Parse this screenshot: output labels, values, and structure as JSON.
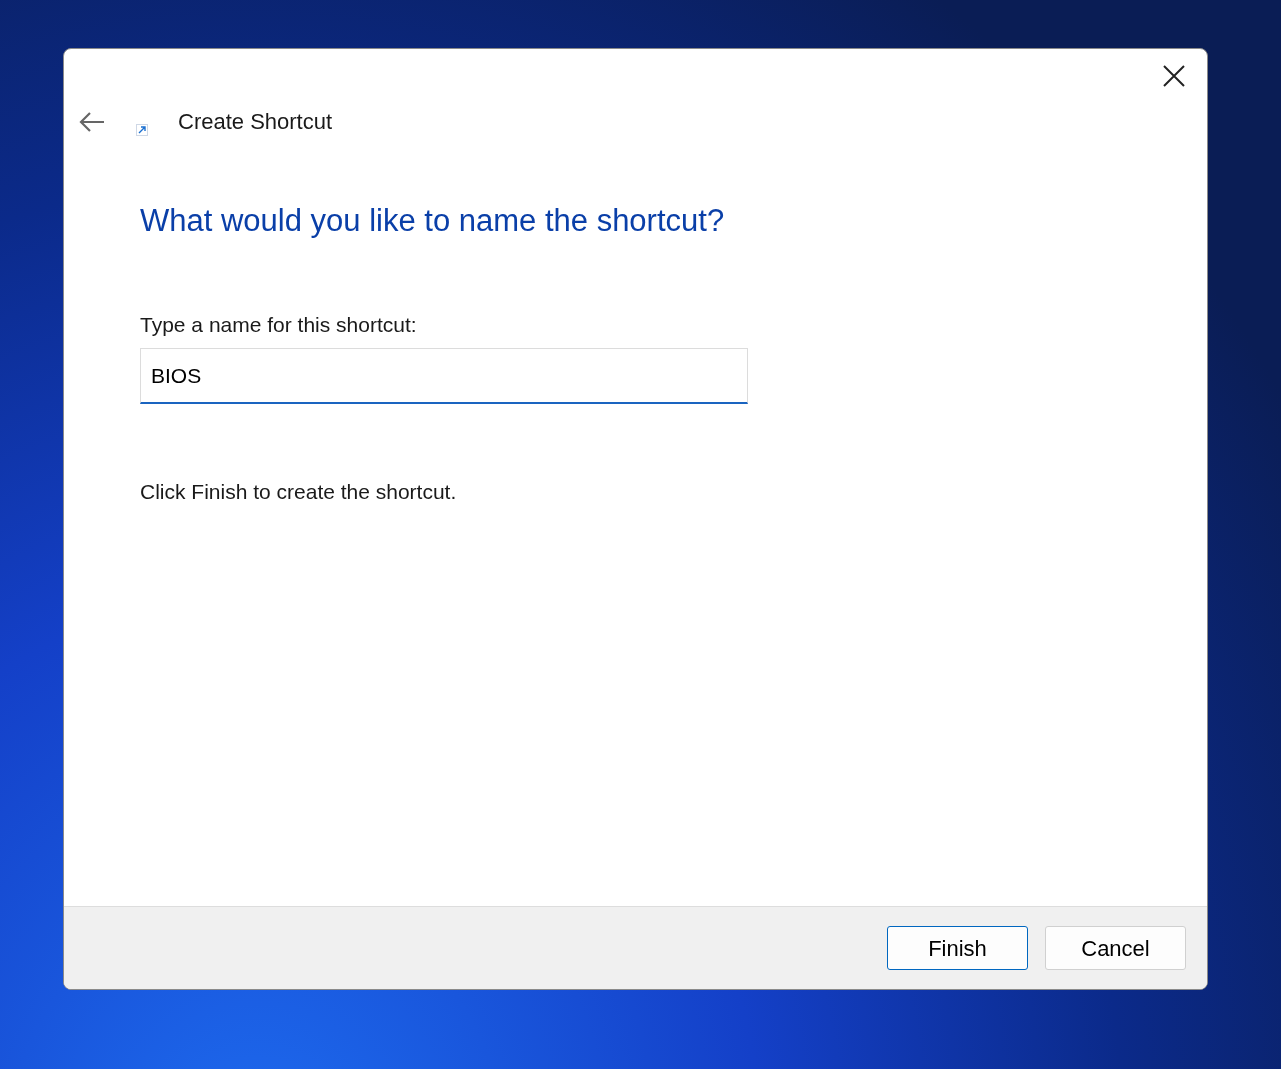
{
  "window": {
    "title": "Create Shortcut"
  },
  "heading": "What would you like to name the shortcut?",
  "name_field": {
    "label": "Type a name for this shortcut:",
    "value": "BIOS"
  },
  "instruction": "Click Finish to create the shortcut.",
  "buttons": [
    {
      "label": "Finish",
      "default": true
    },
    {
      "label": "Cancel",
      "default": false
    }
  ]
}
